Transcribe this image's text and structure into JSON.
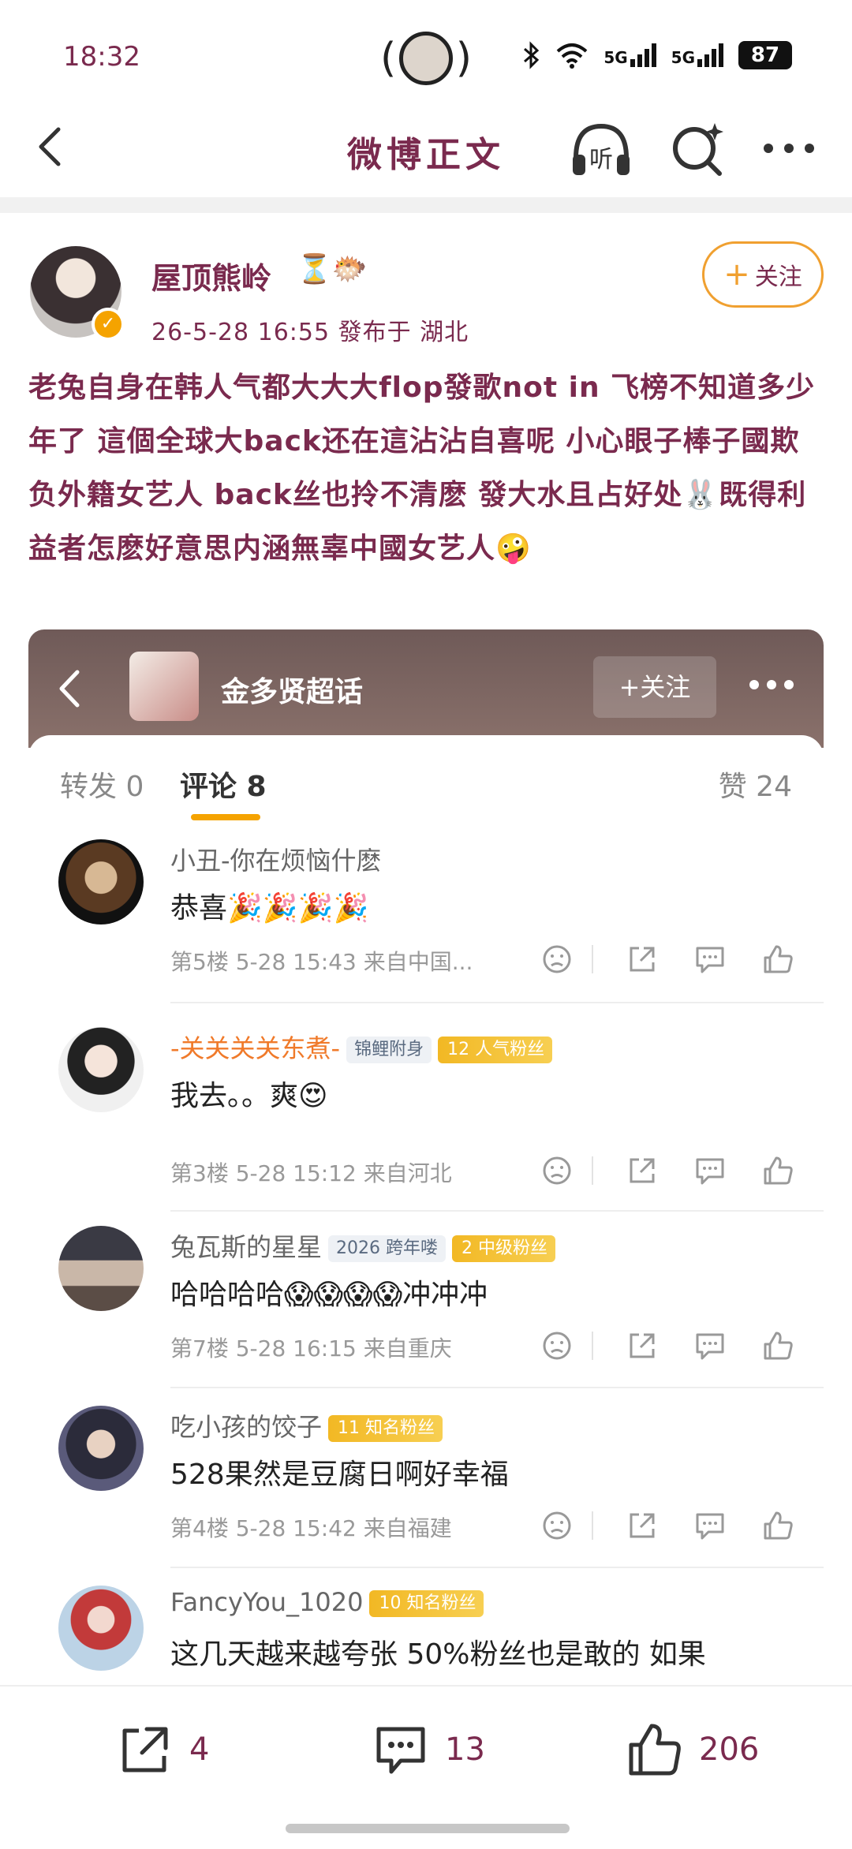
{
  "status_bar": {
    "time": "18:32",
    "network1": "5G",
    "network2": "5G",
    "battery": "87"
  },
  "nav": {
    "title": "微博正文",
    "listen_label": "听"
  },
  "post": {
    "author": "屋顶熊岭",
    "author_emoji": "⏳🐡",
    "meta": "26-5-28  16:55   發布于  湖北",
    "follow_label": "关注",
    "text": "老兔自身在韩人气都大大大flop發歌not in 飞榜不知道多少年了 這個全球大back还在這沾沾自喜呢  小心眼子棒子國欺负外籍女艺人 back丝也拎不清麽 發大水且占好处🐰既得利益者怎麽好意思内涵無辜中國女艺人🤪"
  },
  "embed": {
    "title": "金多贤超话",
    "follow_label": "关注",
    "tabs": {
      "repost": "转发 0",
      "comments": "评论 8",
      "likes": "赞 24"
    },
    "comments": [
      {
        "name": "小丑-你在烦恼什麽",
        "text": "恭喜🎉🎉🎉🎉",
        "meta": "第5楼 5-28 15:43  来自中国...",
        "badges": []
      },
      {
        "name": "-关关关关东煮-",
        "text": "我去。。爽😍",
        "meta": "第3楼 5-28 15:12  来自河北",
        "badges": [
          "锦鲤附身",
          "12 人气粉丝"
        ]
      },
      {
        "name": "兔瓦斯的星星",
        "text": "哈哈哈哈😱😱😱😱冲冲冲",
        "meta": "第7楼 5-28 16:15  来自重庆",
        "badges": [
          "2026 跨年喽",
          "2 中级粉丝"
        ]
      },
      {
        "name": "吃小孩的饺子",
        "text": "528果然是豆腐日啊好幸福",
        "meta": "第4楼 5-28 15:42  来自福建",
        "badges": [
          "11 知名粉丝"
        ]
      },
      {
        "name": "FancyYou_1020",
        "text": "这几天越来越夸张 50%粉丝也是敢的 如果",
        "meta": "",
        "badges": [
          "10 知名粉丝"
        ]
      }
    ]
  },
  "toolbar": {
    "repost_count": "4",
    "comment_count": "13",
    "like_count": "206"
  },
  "colors": {
    "accent_text": "#7a2a4e",
    "follow_border": "#f0a030",
    "tab_underline": "#f5a300"
  }
}
